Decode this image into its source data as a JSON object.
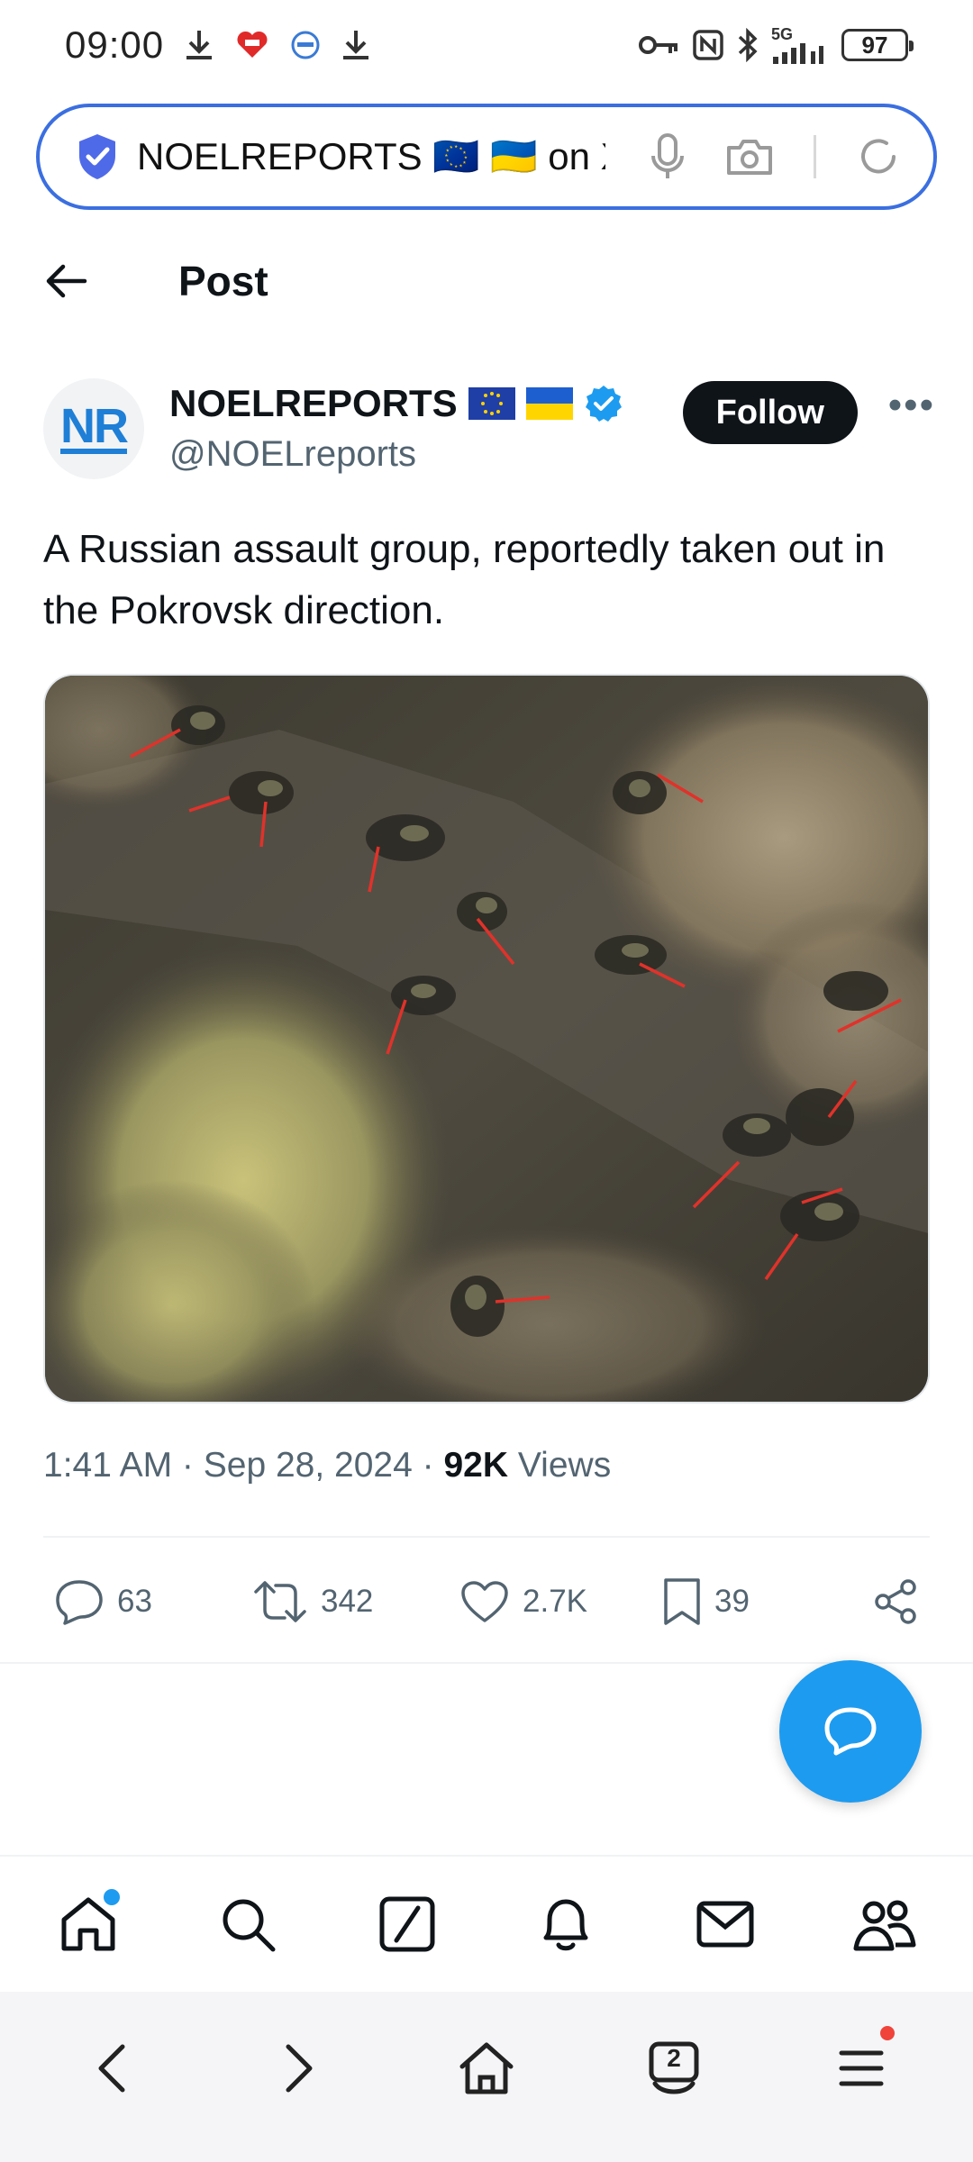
{
  "status_bar": {
    "time": "09:00",
    "battery": "97",
    "network": "5G"
  },
  "url_bar": {
    "text": "NOELREPORTS 🇪🇺 🇺🇦 on X"
  },
  "header": {
    "title": "Post"
  },
  "author": {
    "avatar_text": "NR",
    "name": "NOELREPORTS",
    "handle": "@NOELreports",
    "follow_label": "Follow",
    "more_label": "•••"
  },
  "tweet": {
    "text": "A Russian assault group, reportedly taken out in the Pokrovsk direction."
  },
  "meta": {
    "time": "1:41 AM",
    "sep": " · ",
    "date": "Sep 28, 2024",
    "views_count": "92K",
    "views_label": " Views"
  },
  "actions": {
    "replies": "63",
    "reposts": "342",
    "likes": "2.7K",
    "bookmarks": "39"
  },
  "bottom_nav": {
    "tabs_count": "2"
  },
  "colors": {
    "accent": "#1d9bf0",
    "url_border": "#3b6fe0",
    "follow_bg": "#0f1419",
    "muted": "#536471"
  }
}
